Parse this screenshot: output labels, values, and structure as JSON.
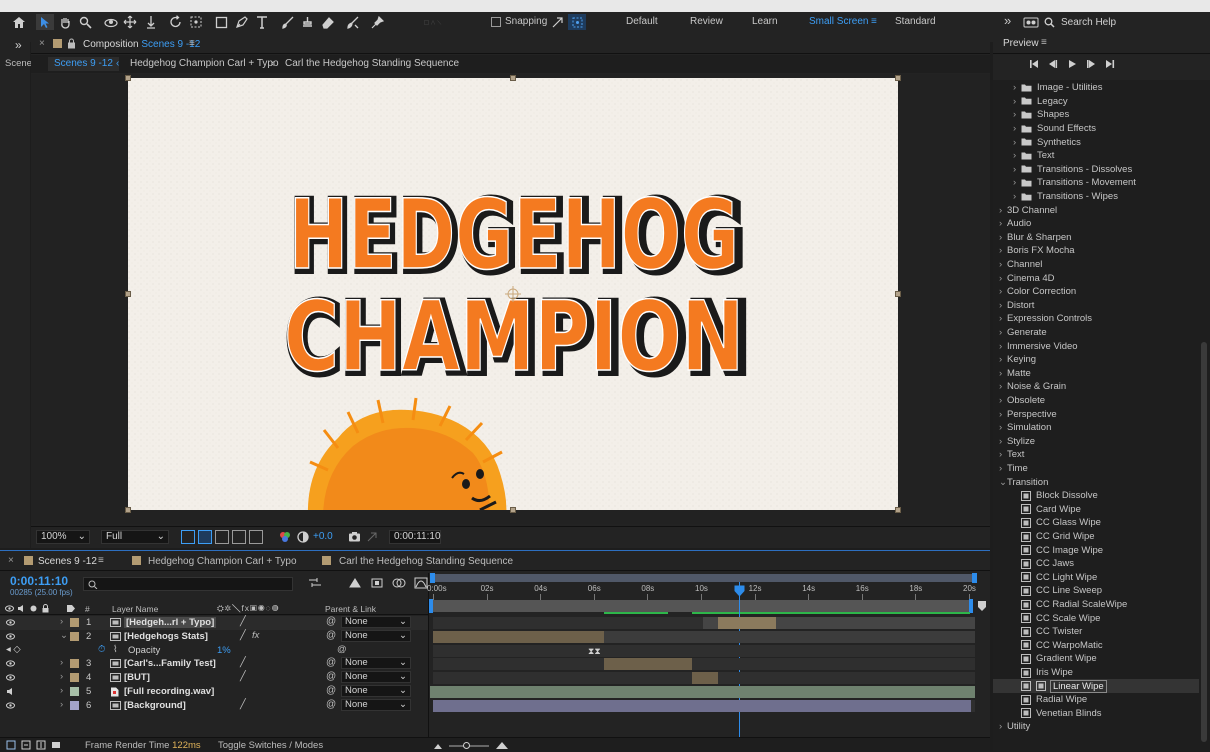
{
  "toolbar": {
    "snapping_label": "Snapping",
    "workspaces": [
      "Default",
      "Review",
      "Learn",
      "Small Screen",
      "Standard"
    ],
    "active_workspace": "Small Screen",
    "search_placeholder": "Search Help"
  },
  "scene_panel": {
    "label": "Scene"
  },
  "composition": {
    "tab_prefix": "Composition",
    "tab_name": "Scenes 9 -12",
    "breadcrumbs": [
      "Scenes 9 -12",
      "Hedgehog Champion Carl + Typo",
      "Carl the Hedgehog Standing Sequence"
    ],
    "canvas_title_line1": "HEDGEHOG",
    "canvas_title_line2": "CHAMPION",
    "zoom": "100%",
    "resolution": "Full",
    "exposure": "+0.0",
    "timecode": "0:00:11:10"
  },
  "preview": {
    "title": "Preview"
  },
  "effects": {
    "subfolders": [
      "Image - Utilities",
      "Legacy",
      "Shapes",
      "Sound Effects",
      "Synthetics",
      "Text",
      "Transitions - Dissolves",
      "Transitions - Movement",
      "Transitions - Wipes"
    ],
    "categories": [
      "3D Channel",
      "Audio",
      "Blur & Sharpen",
      "Boris FX Mocha",
      "Channel",
      "Cinema 4D",
      "Color Correction",
      "Distort",
      "Expression Controls",
      "Generate",
      "Immersive Video",
      "Keying",
      "Matte",
      "Noise & Grain",
      "Obsolete",
      "Perspective",
      "Simulation",
      "Stylize",
      "Text",
      "Time"
    ],
    "open_category": "Transition",
    "transition_items": [
      "Block Dissolve",
      "Card Wipe",
      "CC Glass Wipe",
      "CC Grid Wipe",
      "CC Image Wipe",
      "CC Jaws",
      "CC Light Wipe",
      "CC Line Sweep",
      "CC Radial ScaleWipe",
      "CC Scale Wipe",
      "CC Twister",
      "CC WarpoMatic",
      "Gradient Wipe",
      "Iris Wipe",
      "Linear Wipe",
      "Radial Wipe",
      "Venetian Blinds"
    ],
    "selected_item": "Linear Wipe",
    "last_category": "Utility"
  },
  "timeline": {
    "tabs": [
      "Scenes 9 -12",
      "Hedgehog Champion Carl + Typo",
      "Carl the Hedgehog Standing Sequence"
    ],
    "current_time": "0:00:11:10",
    "frame_info": "00285 (25.00 fps)",
    "col_layer_name": "Layer Name",
    "col_parent": "Parent & Link",
    "col_hash": "#",
    "ruler": [
      "0:00s",
      "02s",
      "04s",
      "06s",
      "08s",
      "10s",
      "12s",
      "14s",
      "16s",
      "18s",
      "20s"
    ],
    "layers": [
      {
        "num": "1",
        "name": "[Hedgeh...rl + Typo]",
        "parent": "None",
        "color": "#b39b72"
      },
      {
        "num": "2",
        "name": "[Hedgehogs Stats]",
        "parent": "None",
        "color": "#b39b72"
      },
      {
        "num": "3",
        "name": "[Carl's...Family Test]",
        "parent": "None",
        "color": "#b39b72"
      },
      {
        "num": "4",
        "name": "[BUT]",
        "parent": "None",
        "color": "#b39b72"
      },
      {
        "num": "5",
        "name": "[Full recording.wav]",
        "parent": "None",
        "color": "#a7bfa7"
      },
      {
        "num": "6",
        "name": "[Background]",
        "parent": "None",
        "color": "#a3a3c8"
      }
    ],
    "opacity_label": "Opacity",
    "opacity_value": "1%",
    "render_time_label": "Frame Render Time",
    "render_time_value": "122ms",
    "toggle_label": "Toggle Switches / Modes"
  },
  "colors": {
    "accent": "#2d8ceb",
    "title_orange": "#f47a20"
  }
}
